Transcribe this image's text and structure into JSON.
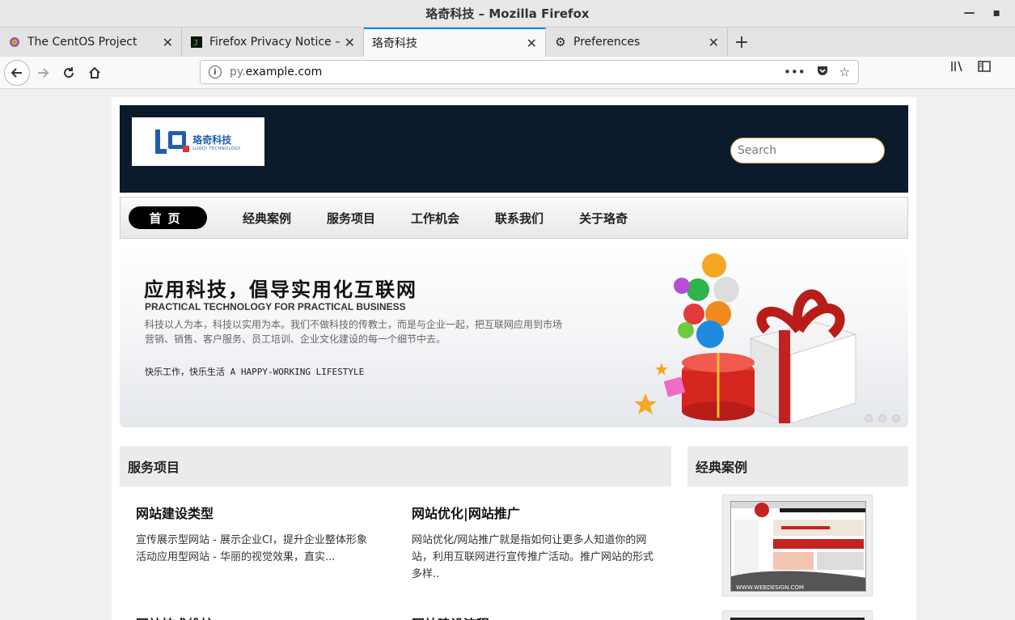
{
  "window": {
    "title": "珞奇科技  –  Mozilla Firefox"
  },
  "tabs": [
    {
      "label": "The CentOS Project",
      "icon": "centos-icon"
    },
    {
      "label": "Firefox Privacy Notice — ",
      "icon": "firefox-privacy-icon"
    },
    {
      "label": "珞奇科技",
      "icon": "none"
    },
    {
      "label": "Preferences",
      "icon": "gear-icon"
    }
  ],
  "urlbar": {
    "prefix": "py.",
    "domain": "example.com"
  },
  "site": {
    "logo": {
      "cn": "珞奇科技",
      "en": "LUOQI TECHNOLOGY"
    },
    "search_placeholder": "Search",
    "menu": [
      "首页",
      "经典案例",
      "服务项目",
      "工作机会",
      "联系我们",
      "关于珞奇"
    ],
    "banner": {
      "title": "应用科技，倡导实用化互联网",
      "subtitle": "PRACTICAL TECHNOLOGY FOR PRACTICAL BUSINESS",
      "desc": "科技以人为本，科技以实用为本。我们不做科技的传教士，而是与企业一起，把互联网应用到市场营销、销售、客户服务、员工培训、企业文化建设的每一个细节中去。",
      "lifestyle": "快乐工作，快乐生活 A HAPPY-WORKING LIFESTYLE"
    },
    "services": {
      "heading": "服务项目",
      "items": [
        {
          "title": "网站建设类型",
          "desc": "宣传展示型网站 - 展示企业CI，提升企业整体形象 活动应用型网站 - 华丽的视觉效果，直实..."
        },
        {
          "title": "网站优化|网站推广",
          "desc": "网站优化/网站推广就是指如何让更多人知道你的网站，利用互联网进行宣传推广活动。推广网站的形式多样.."
        },
        {
          "title": "网站技术维护",
          "desc": ""
        },
        {
          "title": "网站建设流程",
          "desc": ""
        }
      ]
    },
    "cases": {
      "heading": "经典案例",
      "thumb_caption": "WWW.WEBDESIGN.COM"
    }
  }
}
